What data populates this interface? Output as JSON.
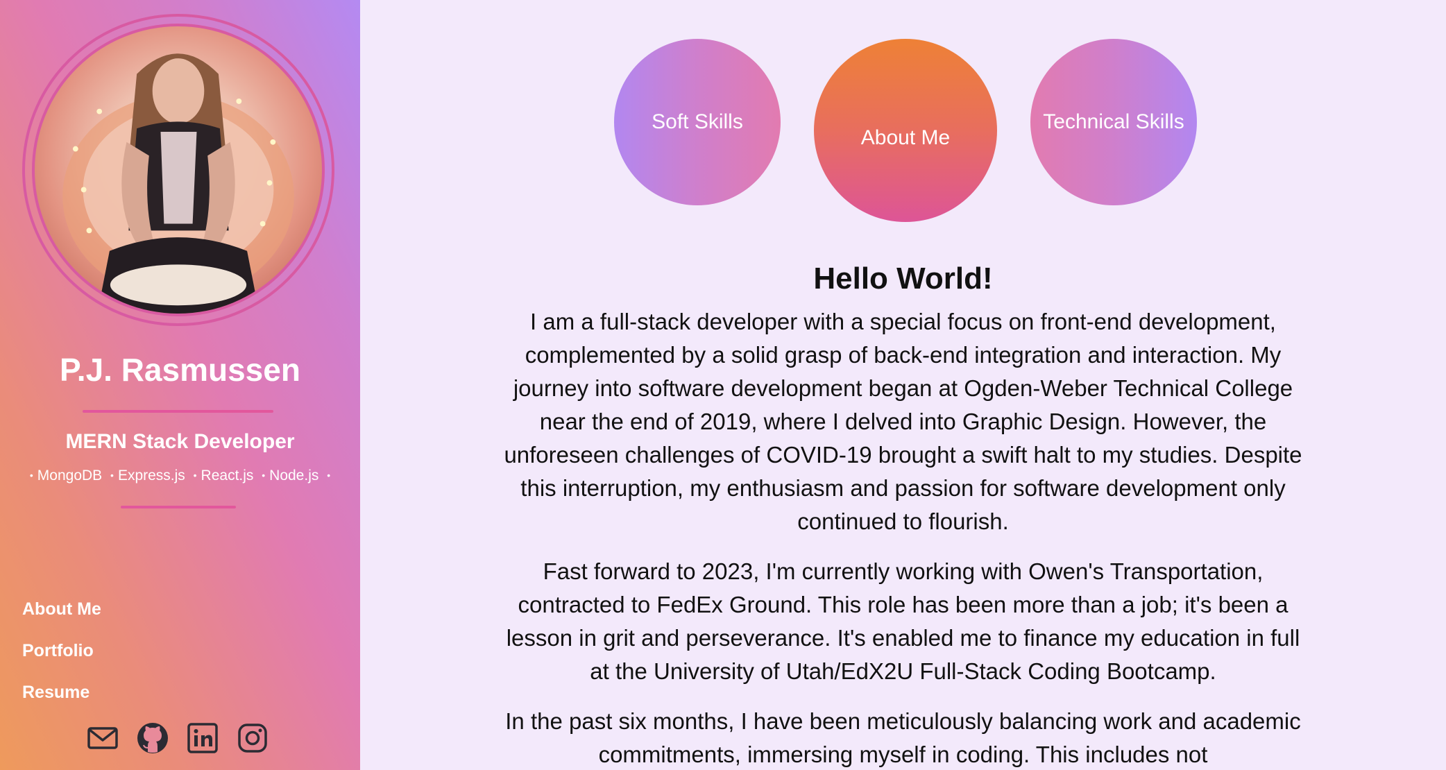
{
  "sidebar": {
    "name": "P.J. Rasmussen",
    "role": "MERN Stack Developer",
    "stack": [
      "MongoDB",
      "Express.js",
      "React.js",
      "Node.js"
    ],
    "nav": [
      "About Me",
      "Portfolio",
      "Resume"
    ],
    "social_icons": [
      "mail-icon",
      "github-icon",
      "linkedin-icon",
      "instagram-icon"
    ]
  },
  "bubbles": {
    "soft": "Soft Skills",
    "about": "About Me",
    "tech": "Technical Skills"
  },
  "content": {
    "heading": "Hello World!",
    "paragraphs": [
      "I am a full-stack developer with a special focus on front-end development, complemented by a solid grasp of back-end integration and interaction. My journey into software development began at Ogden-Weber Technical College near the end of 2019, where I delved into Graphic Design. However, the unforeseen challenges of COVID-19 brought a swift halt to my studies. Despite this interruption, my enthusiasm and passion for software development only continued to flourish.",
      "Fast forward to 2023, I'm currently working with Owen's Transportation, contracted to FedEx Ground. This role has been more than a job; it's been a lesson in grit and perseverance. It's enabled me to finance my education in full at the University of Utah/EdX2U Full-Stack Coding Bootcamp.",
      "In the past six months, I have been meticulously balancing work and academic commitments, immersing myself in coding. This includes not"
    ]
  },
  "colors": {
    "accent_pink": "#e2579c",
    "background": "#f3e9fb",
    "orange": "#ee8136",
    "lavender": "#b287f0"
  }
}
